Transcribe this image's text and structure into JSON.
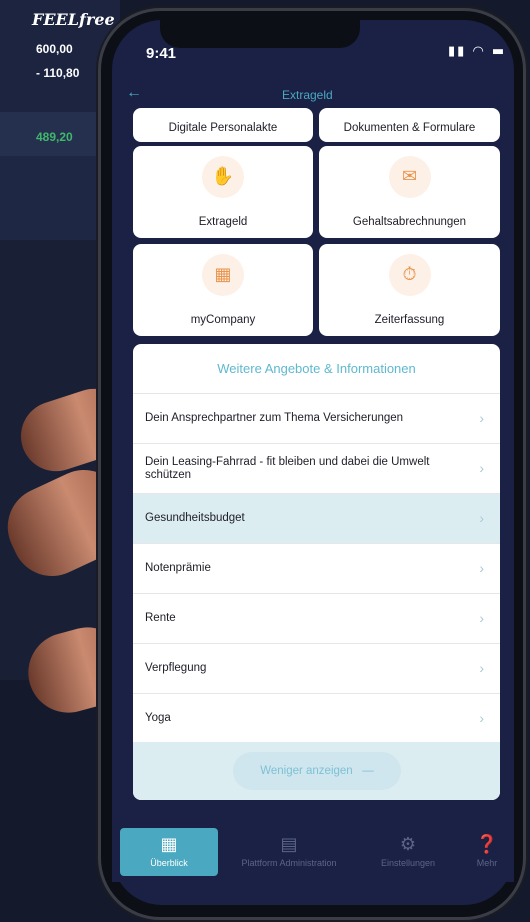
{
  "background_app": {
    "logo": "FEELfree",
    "values": [
      "600,00",
      "- 110,80",
      "489,20"
    ]
  },
  "status_bar": {
    "time": "9:41",
    "icons": "signal-wifi-battery"
  },
  "header": {
    "back_icon": "arrow-left-icon",
    "title": "Extrageld"
  },
  "tiles": {
    "digitale_personalakte": "Digitale Personalakte",
    "dokumente": "Dokumenten & Formulare",
    "extrageld": "Extrageld",
    "gehalt": "Gehaltsabrechnungen",
    "mycompany": "myCompany",
    "zeiterfassung": "Zeiterfassung"
  },
  "list": {
    "title": "Weitere Angebote & Informationen",
    "items": [
      "Dein Ansprechpartner zum Thema Versicherungen",
      "Dein Leasing-Fahrrad - fit bleiben und dabei die Umwelt schützen",
      "Gesundheitsbudget",
      "Notenprämie",
      "Rente",
      "Verpflegung",
      "Yoga"
    ],
    "active_index": 2,
    "less_label": "Weniger anzeigen"
  },
  "tabbar": {
    "overview": "Überblick",
    "platform": "Plattform Administration",
    "settings": "Einstellungen",
    "more": "Mehr"
  },
  "colors": {
    "accent": "#4aa8c0",
    "icon_orange": "#e8954f",
    "dark_bg": "#1a2145"
  }
}
